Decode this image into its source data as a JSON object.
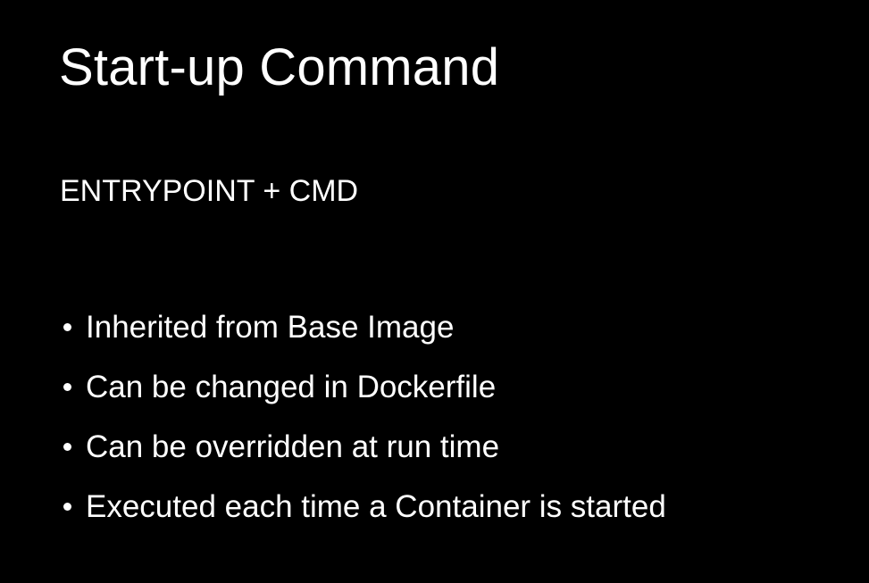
{
  "slide": {
    "title": "Start-up Command",
    "subtitle": "ENTRYPOINT + CMD",
    "bullets": [
      "Inherited from Base Image",
      "Can be changed in Dockerfile",
      "Can be overridden at run time",
      "Executed each time a Container is started"
    ]
  },
  "colors": {
    "background": "#000000",
    "text": "#ffffff"
  }
}
